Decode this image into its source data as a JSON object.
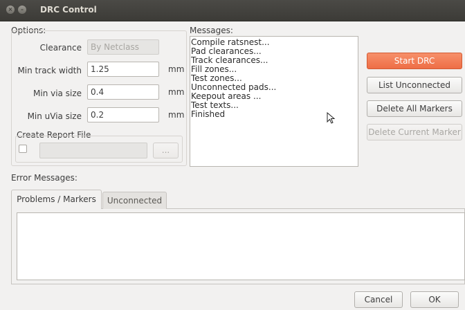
{
  "window": {
    "title": "DRC Control"
  },
  "options": {
    "group_label": "Options:",
    "clearance": {
      "label": "Clearance",
      "value": "By Netclass"
    },
    "min_track_width": {
      "label": "Min track width",
      "value": "1.25",
      "unit": "mm"
    },
    "min_via_size": {
      "label": "Min via size",
      "value": "0.4",
      "unit": "mm"
    },
    "min_uvia_size": {
      "label": "Min uVia size",
      "value": "0.2",
      "unit": "mm"
    },
    "report": {
      "label": "Create Report File",
      "browse_label": "..."
    }
  },
  "messages": {
    "label": "Messages:",
    "lines": [
      "Compile ratsnest...",
      "Pad clearances...",
      "Track clearances...",
      "Fill zones...",
      "Test zones...",
      "Unconnected pads...",
      "Keepout areas ...",
      "Test texts...",
      "Finished"
    ]
  },
  "actions": {
    "start_drc": "Start DRC",
    "list_unconnected": "List Unconnected",
    "delete_all_markers": "Delete All Markers",
    "delete_current_marker": "Delete Current Marker"
  },
  "errors": {
    "label": "Error Messages:",
    "tabs": [
      "Problems / Markers",
      "Unconnected"
    ]
  },
  "footer": {
    "cancel": "Cancel",
    "ok": "OK"
  },
  "colors": {
    "accent": "#ef7a52",
    "titlebar": "#3c3b37"
  }
}
